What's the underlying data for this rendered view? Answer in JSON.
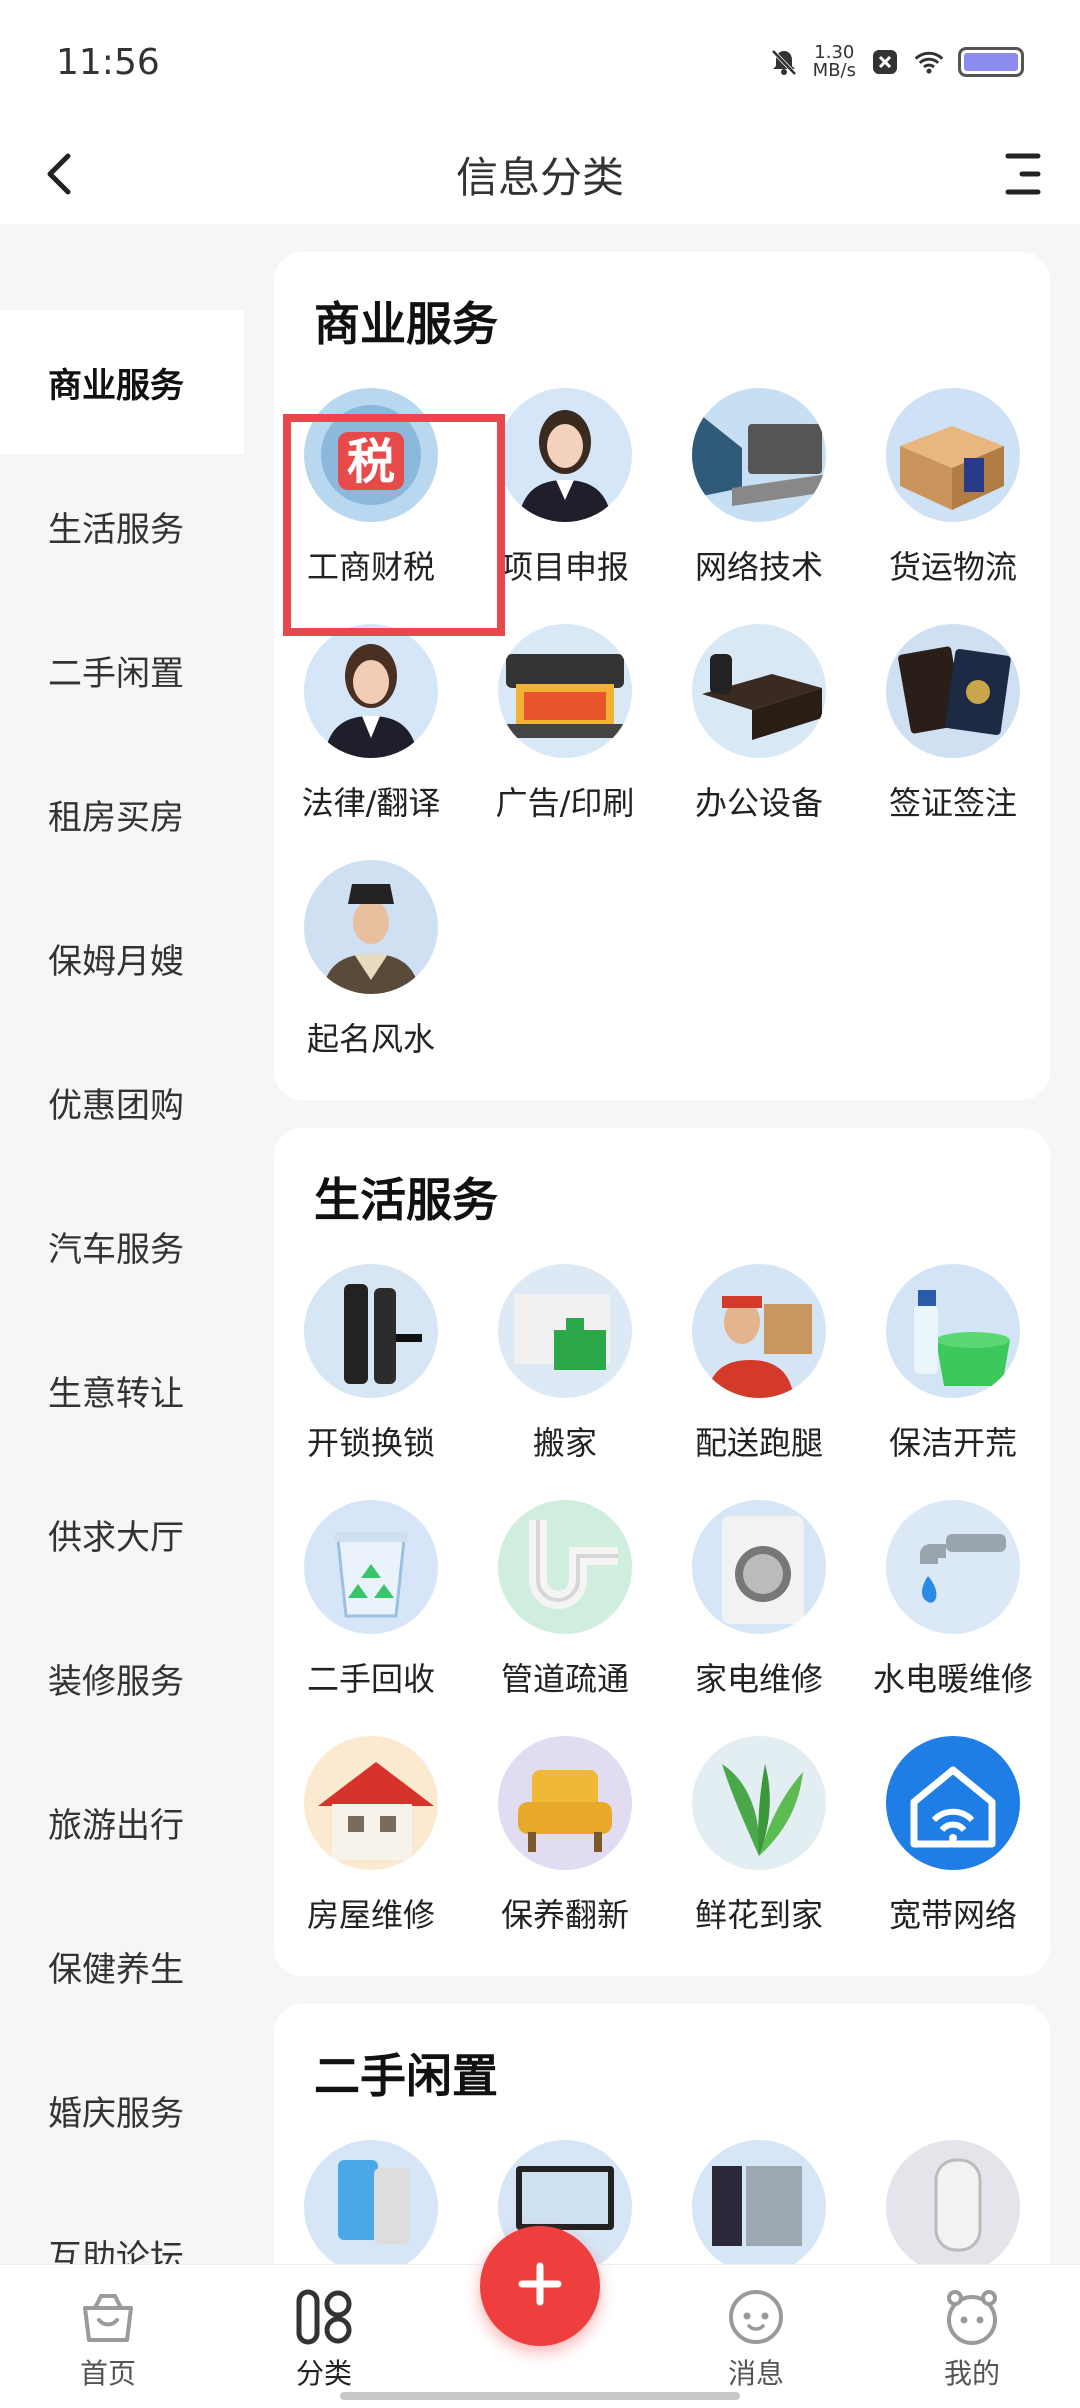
{
  "status_bar": {
    "time": "11:56",
    "speed_value": "1.30",
    "speed_unit": "MB/s",
    "icons": [
      "mute-bell-icon",
      "x-box-icon",
      "wifi-icon",
      "battery-icon"
    ]
  },
  "nav": {
    "title": "信息分类",
    "back_icon": "chevron-left-icon",
    "menu_icon": "menu-lines-icon"
  },
  "sidebar": {
    "items": [
      {
        "label": "商业服务",
        "active": true
      },
      {
        "label": "生活服务",
        "active": false
      },
      {
        "label": "二手闲置",
        "active": false
      },
      {
        "label": "租房买房",
        "active": false
      },
      {
        "label": "保姆月嫂",
        "active": false
      },
      {
        "label": "优惠团购",
        "active": false
      },
      {
        "label": "汽车服务",
        "active": false
      },
      {
        "label": "生意转让",
        "active": false
      },
      {
        "label": "供求大厅",
        "active": false
      },
      {
        "label": "装修服务",
        "active": false
      },
      {
        "label": "旅游出行",
        "active": false
      },
      {
        "label": "保健养生",
        "active": false
      },
      {
        "label": "婚庆服务",
        "active": false
      },
      {
        "label": "互助论坛",
        "active": false
      }
    ]
  },
  "sections": [
    {
      "title": "商业服务",
      "items": [
        {
          "label": "工商财税",
          "icon": "tax-icon",
          "badge": "税",
          "selected": true
        },
        {
          "label": "项目申报",
          "icon": "businesswoman-icon"
        },
        {
          "label": "网络技术",
          "icon": "laptop-icon"
        },
        {
          "label": "货运物流",
          "icon": "cargo-box-icon"
        },
        {
          "label": "法律/翻译",
          "icon": "lawyer-icon"
        },
        {
          "label": "广告/印刷",
          "icon": "printer-icon"
        },
        {
          "label": "办公设备",
          "icon": "office-desk-icon"
        },
        {
          "label": "签证签注",
          "icon": "passport-icon"
        },
        {
          "label": "起名风水",
          "icon": "scholar-icon"
        }
      ]
    },
    {
      "title": "生活服务",
      "items": [
        {
          "label": "开锁换锁",
          "icon": "smart-lock-icon"
        },
        {
          "label": "搬家",
          "icon": "moving-truck-icon"
        },
        {
          "label": "配送跑腿",
          "icon": "courier-icon"
        },
        {
          "label": "保洁开荒",
          "icon": "cleaning-bucket-icon"
        },
        {
          "label": "二手回收",
          "icon": "recycle-bin-icon"
        },
        {
          "label": "管道疏通",
          "icon": "pipe-icon"
        },
        {
          "label": "家电维修",
          "icon": "washing-machine-icon"
        },
        {
          "label": "水电暖维修",
          "icon": "faucet-icon"
        },
        {
          "label": "房屋维修",
          "icon": "house-icon"
        },
        {
          "label": "保养翻新",
          "icon": "armchair-icon"
        },
        {
          "label": "鲜花到家",
          "icon": "plant-icon"
        },
        {
          "label": "宽带网络",
          "icon": "wifi-house-icon"
        }
      ]
    },
    {
      "title": "二手闲置",
      "items": [
        {
          "label": "",
          "icon": "phone-icon"
        },
        {
          "label": "",
          "icon": "monitor-icon"
        },
        {
          "label": "",
          "icon": "fridge-icon"
        },
        {
          "label": "",
          "icon": "appliance-icon"
        }
      ]
    }
  ],
  "tab_bar": {
    "items": [
      {
        "label": "首页",
        "icon": "home-basket-icon"
      },
      {
        "label": "分类",
        "icon": "category-icon",
        "active": true
      },
      {
        "label": "消息",
        "icon": "message-face-icon"
      },
      {
        "label": "我的",
        "icon": "profile-face-icon"
      }
    ],
    "fab_icon": "plus-icon"
  }
}
